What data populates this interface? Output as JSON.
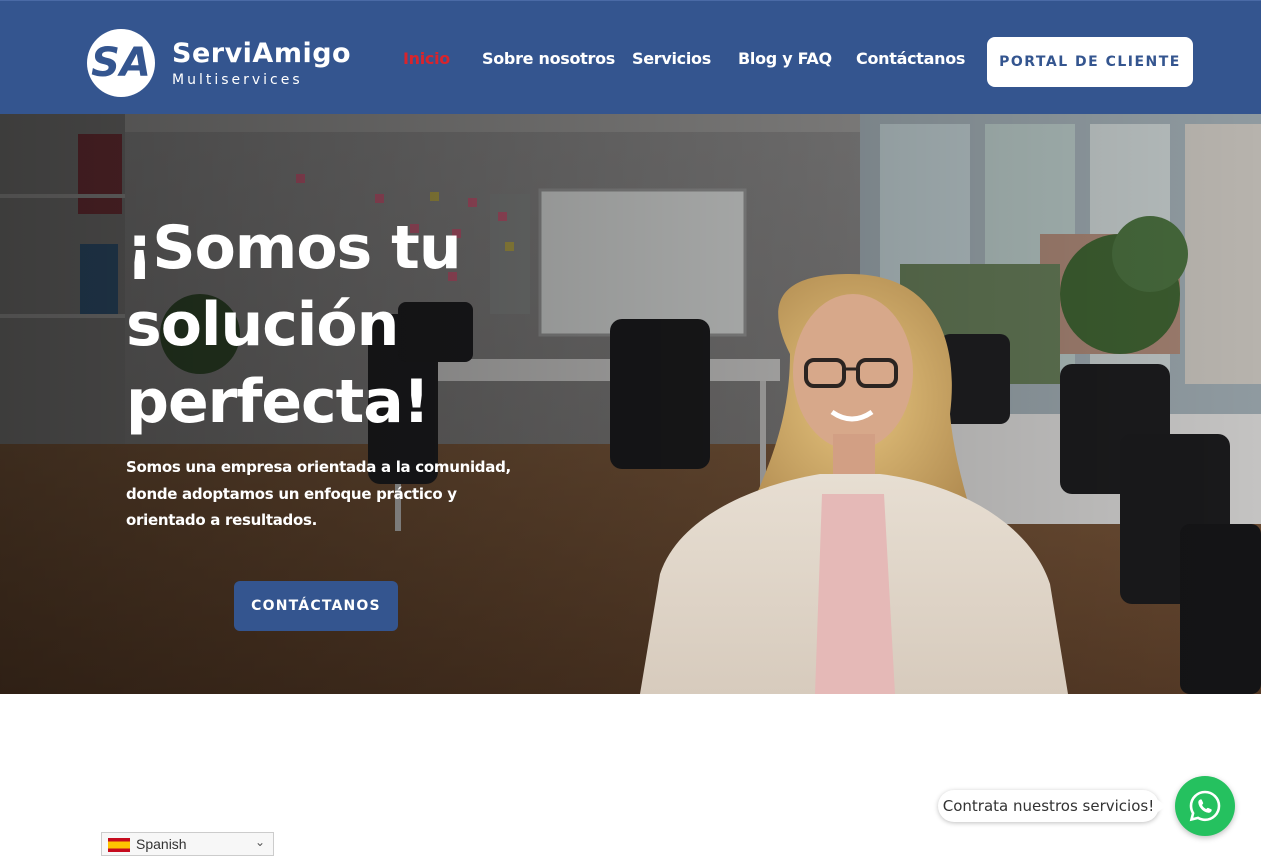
{
  "header": {
    "logo_mark": "SA",
    "logo_name": "ServiAmigo",
    "logo_sub": "Multiservices",
    "nav": [
      {
        "label": "Inicio",
        "active": true
      },
      {
        "label": "Sobre nosotros",
        "active": false
      },
      {
        "label": "Servicios",
        "active": false
      },
      {
        "label": "Blog y FAQ",
        "active": false
      },
      {
        "label": "Contáctanos",
        "active": false
      }
    ],
    "portal_button": "PORTAL DE CLIENTE"
  },
  "hero": {
    "title": "¡Somos tu solución perfecta!",
    "subtitle": "Somos una empresa orientada a la comunidad, donde adoptamos un enfoque práctico y orientado a resultados.",
    "cta_button": "CONTÁCTANOS"
  },
  "language_selector": {
    "selected": "Spanish",
    "icon": "spain-flag-icon"
  },
  "whatsapp": {
    "bubble_text": "Contrata nuestros servicios!",
    "icon": "whatsapp-icon"
  },
  "colors": {
    "brand_blue": "#34558f",
    "active_nav": "#d8242c",
    "whatsapp_green": "#25c15f"
  }
}
